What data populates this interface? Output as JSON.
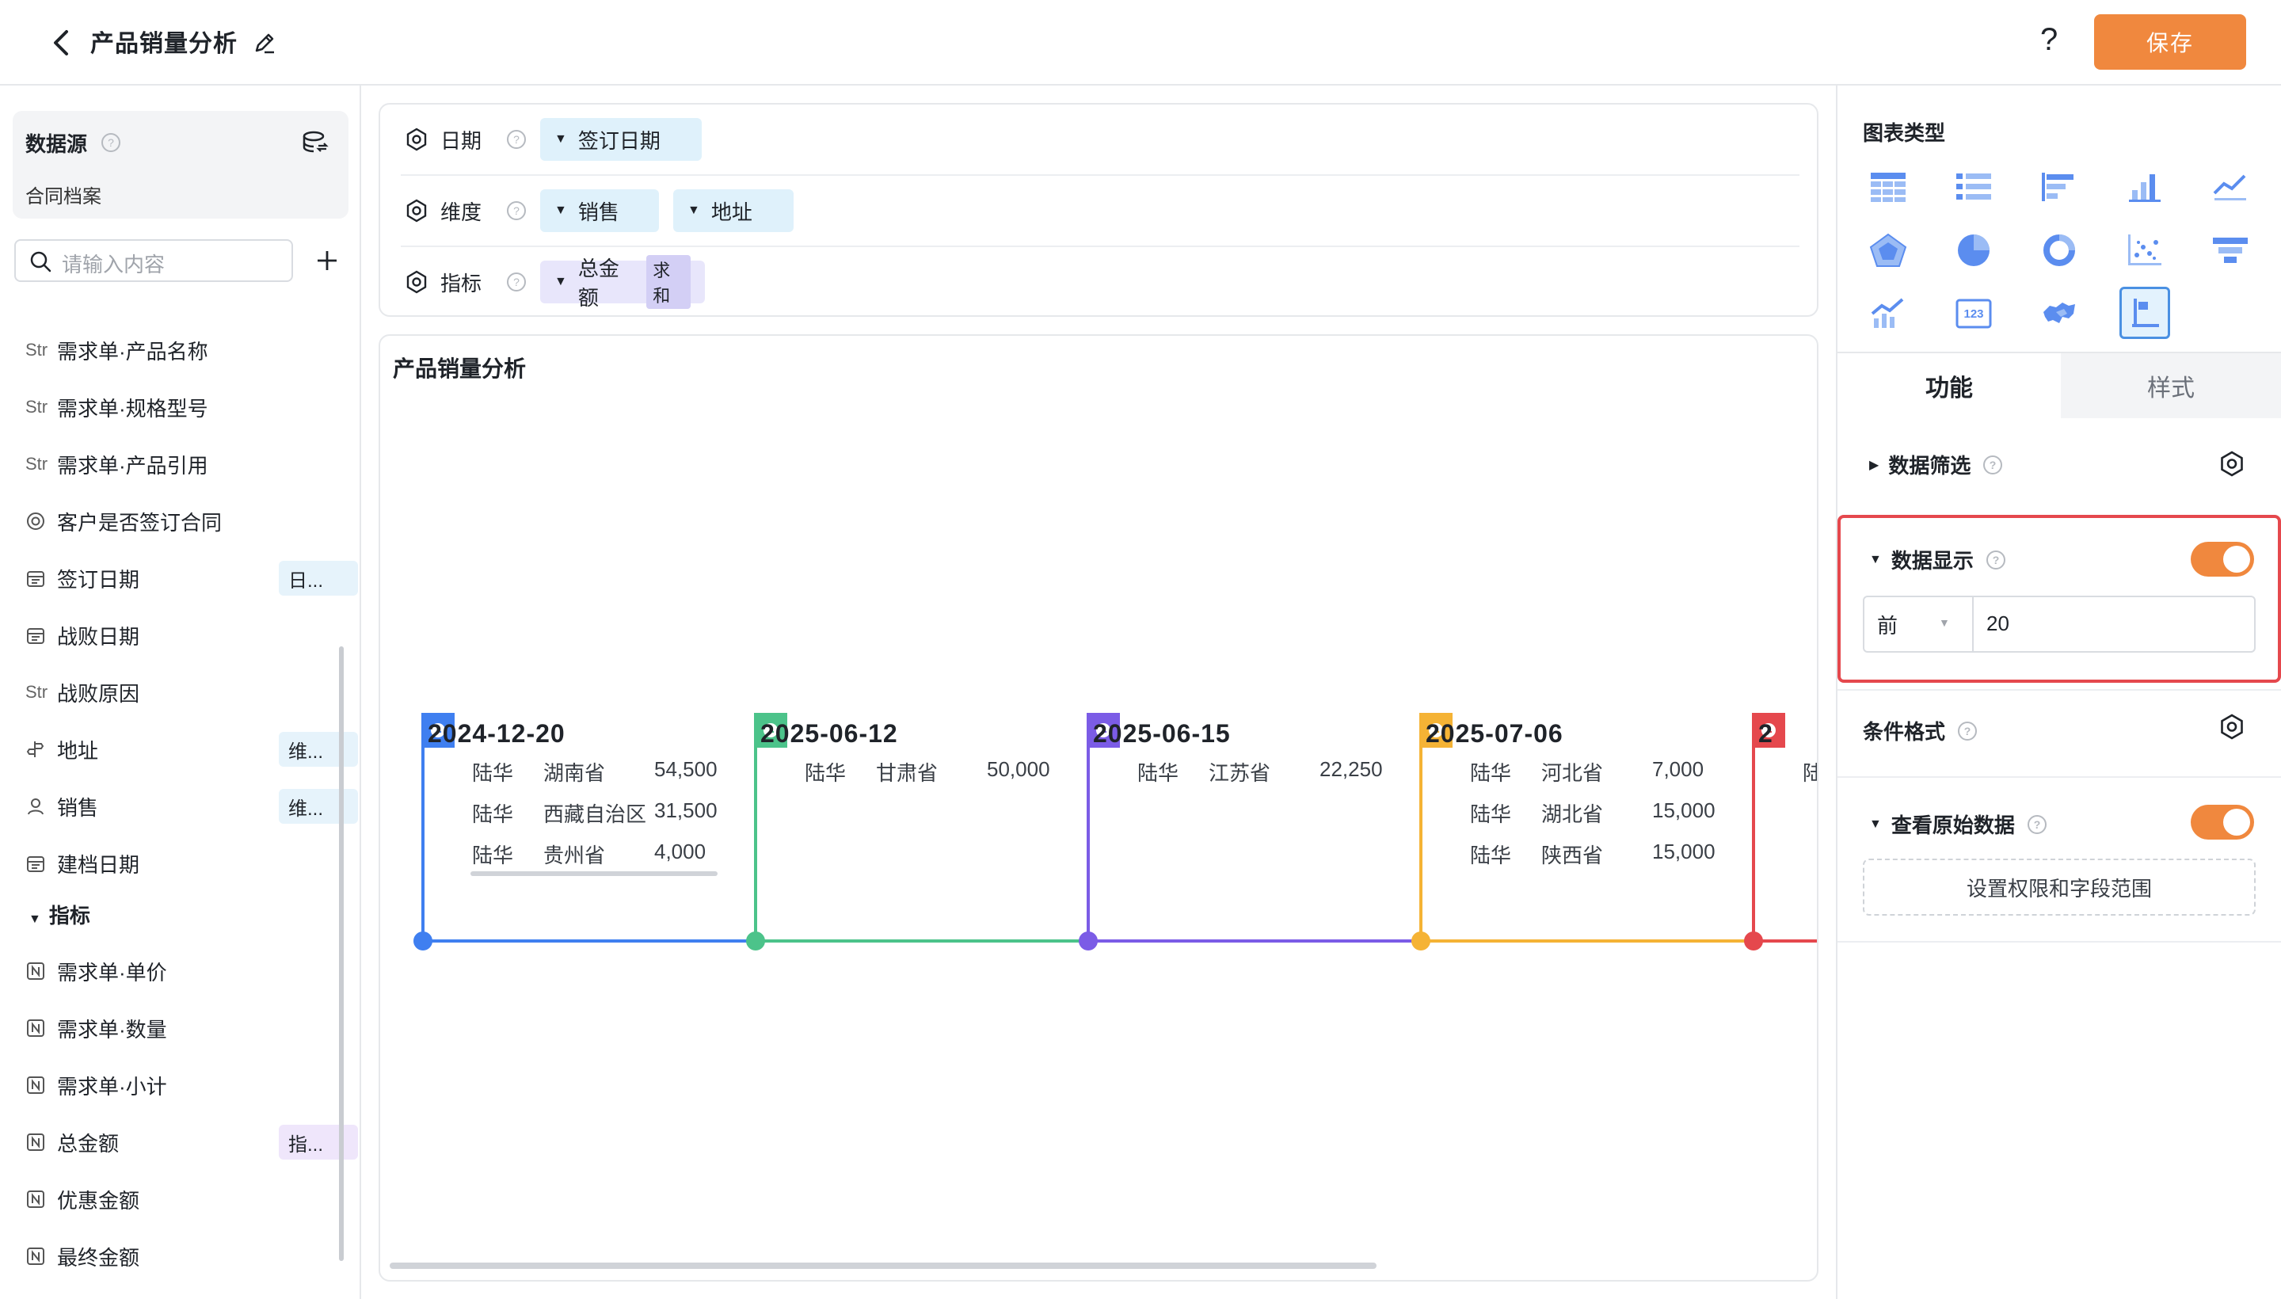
{
  "header": {
    "title": "产品销量分析",
    "help_label": "?",
    "save_label": "保存"
  },
  "sidebar": {
    "datasource_title": "数据源",
    "datasource_name": "合同档案",
    "search_placeholder": "请输入内容",
    "fields": [
      {
        "icon": "Str",
        "label": "需求单·产品名称",
        "tag": ""
      },
      {
        "icon": "Str",
        "label": "需求单·规格型号",
        "tag": ""
      },
      {
        "icon": "Str",
        "label": "需求单·产品引用",
        "tag": ""
      },
      {
        "icon": "radio",
        "label": "客户是否签订合同",
        "tag": ""
      },
      {
        "icon": "date",
        "label": "签订日期",
        "tag": "日..."
      },
      {
        "icon": "date",
        "label": "战败日期",
        "tag": ""
      },
      {
        "icon": "Str",
        "label": "战败原因",
        "tag": ""
      },
      {
        "icon": "location",
        "label": "地址",
        "tag": "维..."
      },
      {
        "icon": "user",
        "label": "销售",
        "tag": "维..."
      },
      {
        "icon": "date",
        "label": "建档日期",
        "tag": ""
      }
    ],
    "metrics_group_title": "指标",
    "metrics": [
      {
        "label": "需求单·单价",
        "tag": ""
      },
      {
        "label": "需求单·数量",
        "tag": ""
      },
      {
        "label": "需求单·小计",
        "tag": ""
      },
      {
        "label": "总金额",
        "tag": "指..."
      },
      {
        "label": "优惠金额",
        "tag": ""
      },
      {
        "label": "最终金额",
        "tag": ""
      }
    ]
  },
  "config": {
    "date_label": "日期",
    "date_field": "签订日期",
    "dimension_label": "维度",
    "dimension_fields": [
      "销售",
      "地址"
    ],
    "metric_label": "指标",
    "metric_field": "总金额",
    "metric_agg": "求和"
  },
  "chart": {
    "title": "产品销量分析",
    "colors": [
      "#3f7ff0",
      "#4cc38a",
      "#7b5ce6",
      "#f5b335",
      "#e5484d"
    ],
    "entries": [
      {
        "date": "2024-12-20",
        "rows": [
          [
            "陆华",
            "湖南省",
            "54,500"
          ],
          [
            "陆华",
            "西藏自治区",
            "31,500"
          ],
          [
            "陆华",
            "贵州省",
            "4,000"
          ]
        ]
      },
      {
        "date": "2025-06-12",
        "rows": [
          [
            "陆华",
            "甘肃省",
            "50,000"
          ]
        ]
      },
      {
        "date": "2025-06-15",
        "rows": [
          [
            "陆华",
            "江苏省",
            "22,250"
          ]
        ]
      },
      {
        "date": "2025-07-06",
        "rows": [
          [
            "陆华",
            "河北省",
            "7,000"
          ],
          [
            "陆华",
            "湖北省",
            "15,000"
          ],
          [
            "陆华",
            "陕西省",
            "15,000"
          ]
        ]
      },
      {
        "date": "2",
        "rows": [
          [
            "陆",
            "",
            ""
          ]
        ]
      }
    ]
  },
  "right": {
    "chart_type_title": "图表类型",
    "tab_function": "功能",
    "tab_style": "样式",
    "data_filter": "数据筛选",
    "data_display": "数据显示",
    "display_mode": "前",
    "display_count": "20",
    "condition_format": "条件格式",
    "view_raw": "查看原始数据",
    "permission_button": "设置权限和字段范围"
  }
}
